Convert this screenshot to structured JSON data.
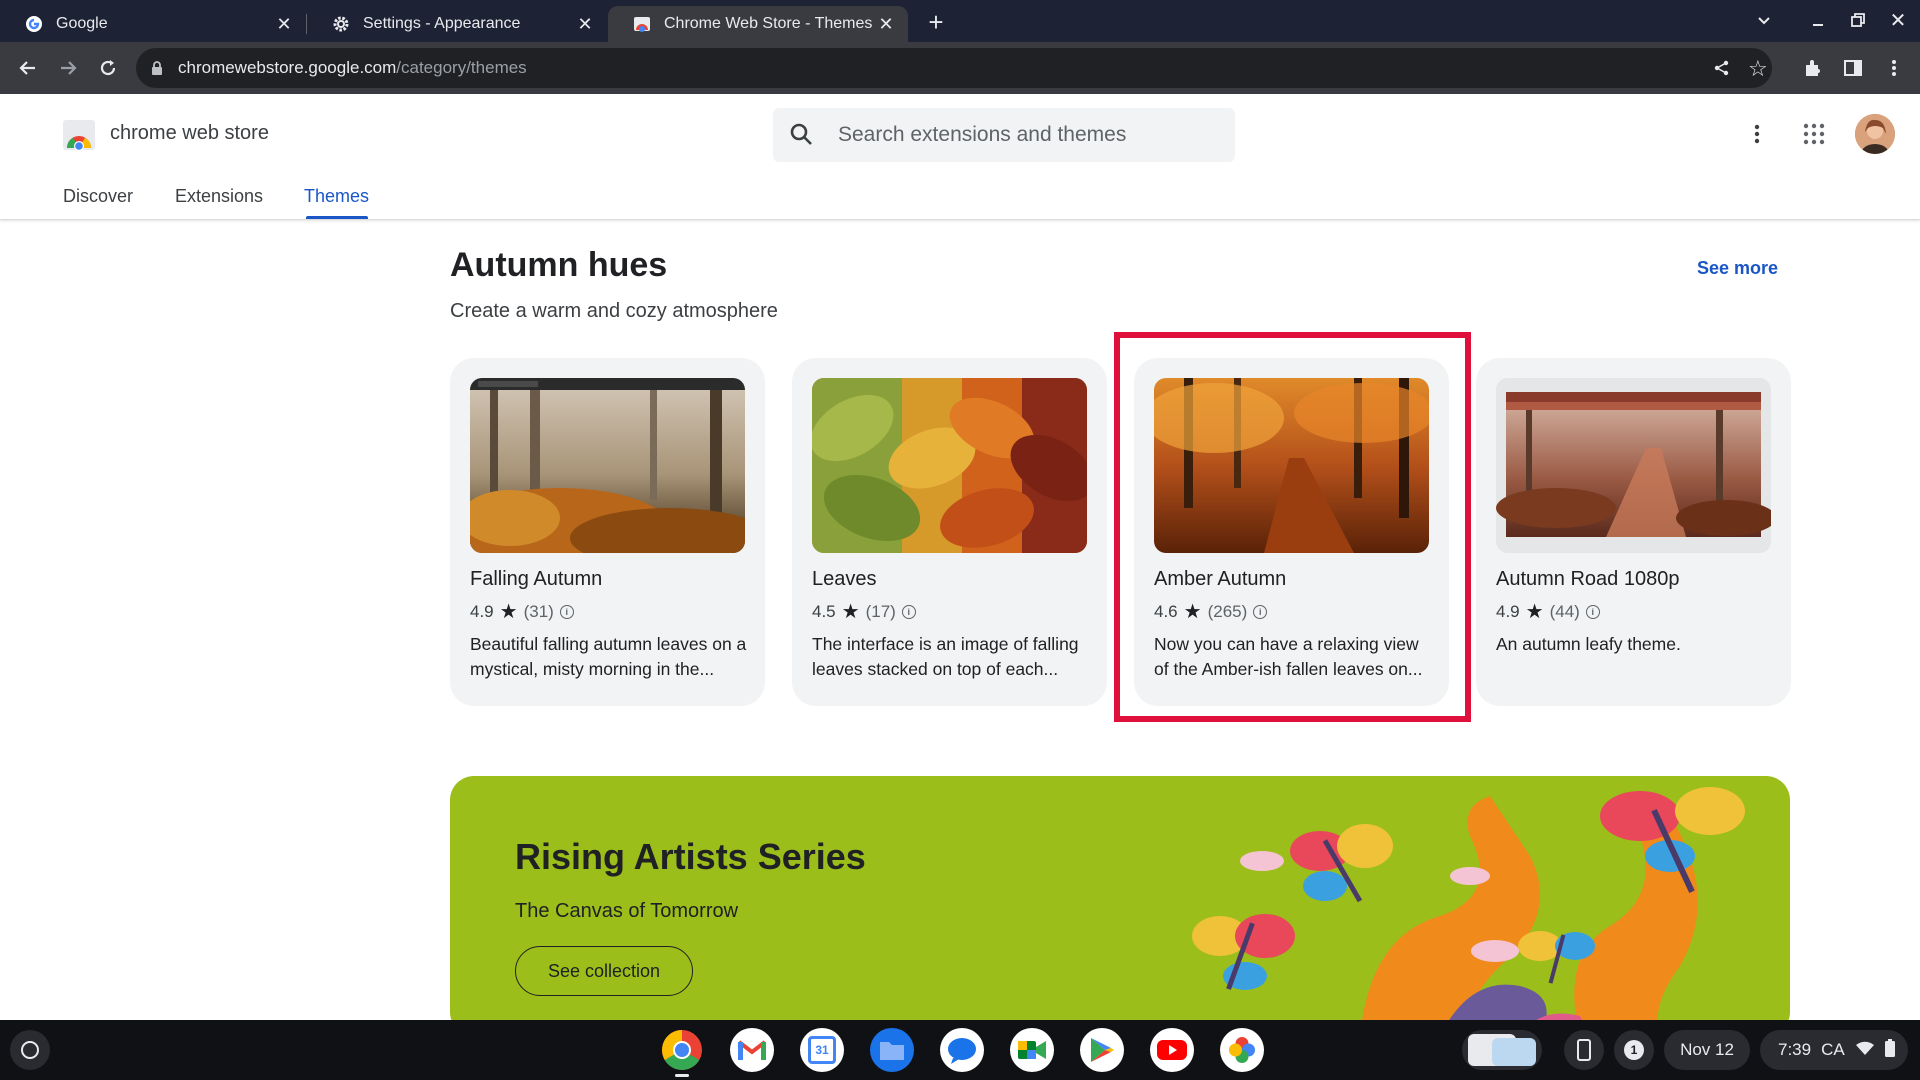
{
  "browser": {
    "tabs": [
      {
        "title": "Google",
        "icon": "google-g-icon",
        "active": false
      },
      {
        "title": "Settings - Appearance",
        "icon": "gear-icon",
        "active": false
      },
      {
        "title": "Chrome Web Store - Themes",
        "icon": "chrome-web-store-icon",
        "active": true
      }
    ],
    "url_host": "chromewebstore.google.com",
    "url_path": "/category/themes"
  },
  "store": {
    "brand": "chrome web store",
    "search_placeholder": "Search extensions and themes",
    "nav": [
      {
        "label": "Discover",
        "active": false
      },
      {
        "label": "Extensions",
        "active": false
      },
      {
        "label": "Themes",
        "active": true
      }
    ]
  },
  "section": {
    "title": "Autumn hues",
    "subtitle": "Create a warm and cozy atmosphere",
    "see_more": "See more",
    "cards": [
      {
        "name": "Falling Autumn",
        "rating": "4.9",
        "count": "(31)",
        "desc": "Beautiful falling autumn leaves on a mystical, misty morning in the...",
        "highlighted": false
      },
      {
        "name": "Leaves",
        "rating": "4.5",
        "count": "(17)",
        "desc": "The interface is an image of falling leaves stacked on top of each...",
        "highlighted": false
      },
      {
        "name": "Amber Autumn",
        "rating": "4.6",
        "count": "(265)",
        "desc": "Now you can have a relaxing view of the Amber-ish fallen leaves on...",
        "highlighted": true
      },
      {
        "name": "Autumn Road 1080p",
        "rating": "4.9",
        "count": "(44)",
        "desc": "An autumn leafy theme.",
        "highlighted": false
      }
    ]
  },
  "banner": {
    "title": "Rising Artists Series",
    "subtitle": "The Canvas of Tomorrow",
    "button": "See collection",
    "color": "#9cbe1a"
  },
  "shelf": {
    "apps": [
      "chrome-icon",
      "gmail-icon",
      "calendar-icon",
      "files-icon",
      "messages-icon",
      "meet-icon",
      "play-store-icon",
      "youtube-icon",
      "photos-icon"
    ],
    "calendar_day": "31",
    "notification_count": "1",
    "date": "Nov 12",
    "time": "7:39",
    "locale": "CA"
  },
  "colors": {
    "accent": "#1a56c6",
    "highlight": "#e0103c"
  }
}
